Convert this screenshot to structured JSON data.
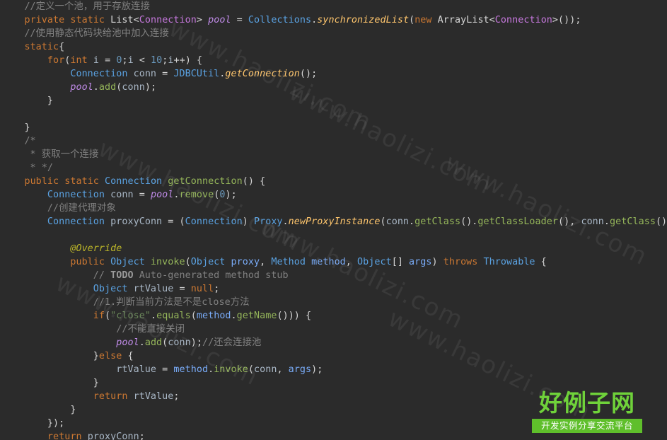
{
  "code_lines": [
    {
      "tokens": [
        {
          "t": "    //定义一个池，用于存放连接",
          "c": "c"
        }
      ]
    },
    {
      "tokens": [
        {
          "t": "    ",
          "c": "t"
        },
        {
          "t": "private",
          "c": "k"
        },
        {
          "t": " ",
          "c": "t"
        },
        {
          "t": "static",
          "c": "k"
        },
        {
          "t": " ",
          "c": "t"
        },
        {
          "t": "List",
          "c": "w"
        },
        {
          "t": "<",
          "c": "t"
        },
        {
          "t": "Connection",
          "c": "tv"
        },
        {
          "t": "> ",
          "c": "t"
        },
        {
          "t": "pool",
          "c": "f"
        },
        {
          "t": " = ",
          "c": "t"
        },
        {
          "t": "Collections",
          "c": "cls"
        },
        {
          "t": ".",
          "c": "t"
        },
        {
          "t": "synchronizedList",
          "c": "sm"
        },
        {
          "t": "(",
          "c": "t"
        },
        {
          "t": "new",
          "c": "k"
        },
        {
          "t": " ",
          "c": "t"
        },
        {
          "t": "ArrayList",
          "c": "w"
        },
        {
          "t": "<",
          "c": "t"
        },
        {
          "t": "Connection",
          "c": "tv"
        },
        {
          "t": ">());",
          "c": "t"
        }
      ]
    },
    {
      "tokens": [
        {
          "t": "    //使用静态代码块给池中加入连接",
          "c": "c"
        }
      ]
    },
    {
      "tokens": [
        {
          "t": "    ",
          "c": "t"
        },
        {
          "t": "static",
          "c": "k"
        },
        {
          "t": "{",
          "c": "t"
        }
      ]
    },
    {
      "tokens": [
        {
          "t": "        ",
          "c": "t"
        },
        {
          "t": "for",
          "c": "k"
        },
        {
          "t": "(",
          "c": "t"
        },
        {
          "t": "int",
          "c": "k"
        },
        {
          "t": " ",
          "c": "t"
        },
        {
          "t": "i",
          "c": "v"
        },
        {
          "t": " = ",
          "c": "t"
        },
        {
          "t": "0",
          "c": "n"
        },
        {
          "t": ";",
          "c": "t"
        },
        {
          "t": "i",
          "c": "v"
        },
        {
          "t": " < ",
          "c": "t"
        },
        {
          "t": "10",
          "c": "n"
        },
        {
          "t": ";",
          "c": "t"
        },
        {
          "t": "i",
          "c": "v"
        },
        {
          "t": "++) {",
          "c": "t"
        }
      ]
    },
    {
      "tokens": [
        {
          "t": "            ",
          "c": "t"
        },
        {
          "t": "Connection",
          "c": "ty"
        },
        {
          "t": " ",
          "c": "t"
        },
        {
          "t": "conn",
          "c": "v"
        },
        {
          "t": " = ",
          "c": "t"
        },
        {
          "t": "JDBCUtil",
          "c": "cls"
        },
        {
          "t": ".",
          "c": "t"
        },
        {
          "t": "getConnection",
          "c": "sm"
        },
        {
          "t": "();",
          "c": "t"
        }
      ]
    },
    {
      "tokens": [
        {
          "t": "            ",
          "c": "t"
        },
        {
          "t": "pool",
          "c": "f"
        },
        {
          "t": ".",
          "c": "t"
        },
        {
          "t": "add",
          "c": "m"
        },
        {
          "t": "(",
          "c": "t"
        },
        {
          "t": "conn",
          "c": "v"
        },
        {
          "t": ");",
          "c": "t"
        }
      ]
    },
    {
      "tokens": [
        {
          "t": "        }",
          "c": "t"
        }
      ]
    },
    {
      "tokens": [
        {
          "t": "",
          "c": "t"
        }
      ]
    },
    {
      "tokens": [
        {
          "t": "    }",
          "c": "t"
        }
      ]
    },
    {
      "tokens": [
        {
          "t": "    /*",
          "c": "c"
        }
      ]
    },
    {
      "tokens": [
        {
          "t": "     * 获取一个连接",
          "c": "c"
        }
      ]
    },
    {
      "tokens": [
        {
          "t": "     * */",
          "c": "c"
        }
      ]
    },
    {
      "tokens": [
        {
          "t": "    ",
          "c": "t"
        },
        {
          "t": "public",
          "c": "k"
        },
        {
          "t": " ",
          "c": "t"
        },
        {
          "t": "static",
          "c": "k"
        },
        {
          "t": " ",
          "c": "t"
        },
        {
          "t": "Connection",
          "c": "ty"
        },
        {
          "t": " ",
          "c": "t"
        },
        {
          "t": "getConnection",
          "c": "m"
        },
        {
          "t": "() {",
          "c": "t"
        }
      ]
    },
    {
      "tokens": [
        {
          "t": "        ",
          "c": "t"
        },
        {
          "t": "Connection",
          "c": "ty"
        },
        {
          "t": " ",
          "c": "t"
        },
        {
          "t": "conn",
          "c": "v"
        },
        {
          "t": " = ",
          "c": "t"
        },
        {
          "t": "pool",
          "c": "f"
        },
        {
          "t": ".",
          "c": "t"
        },
        {
          "t": "remove",
          "c": "m"
        },
        {
          "t": "(",
          "c": "t"
        },
        {
          "t": "0",
          "c": "n"
        },
        {
          "t": ");",
          "c": "t"
        }
      ]
    },
    {
      "tokens": [
        {
          "t": "        //创建代理对象",
          "c": "c"
        }
      ]
    },
    {
      "tokens": [
        {
          "t": "        ",
          "c": "t"
        },
        {
          "t": "Connection",
          "c": "ty"
        },
        {
          "t": " ",
          "c": "t"
        },
        {
          "t": "proxyConn",
          "c": "v"
        },
        {
          "t": " = (",
          "c": "t"
        },
        {
          "t": "Connection",
          "c": "ty"
        },
        {
          "t": ") ",
          "c": "t"
        },
        {
          "t": "Proxy",
          "c": "cls"
        },
        {
          "t": ".",
          "c": "t"
        },
        {
          "t": "newProxyInstance",
          "c": "sm"
        },
        {
          "t": "(",
          "c": "t"
        },
        {
          "t": "conn",
          "c": "v"
        },
        {
          "t": ".",
          "c": "t"
        },
        {
          "t": "getClass",
          "c": "m"
        },
        {
          "t": "().",
          "c": "t"
        },
        {
          "t": "getClassLoader",
          "c": "m"
        },
        {
          "t": "(), ",
          "c": "t"
        },
        {
          "t": "conn",
          "c": "v"
        },
        {
          "t": ".",
          "c": "t"
        },
        {
          "t": "getClass",
          "c": "m"
        },
        {
          "t": "().",
          "c": "t"
        }
      ]
    },
    {
      "tokens": [
        {
          "t": "",
          "c": "t"
        }
      ]
    },
    {
      "tokens": [
        {
          "t": "            ",
          "c": "t"
        },
        {
          "t": "@Override",
          "c": "a"
        }
      ]
    },
    {
      "tokens": [
        {
          "t": "            ",
          "c": "t"
        },
        {
          "t": "public",
          "c": "k"
        },
        {
          "t": " ",
          "c": "t"
        },
        {
          "t": "Object",
          "c": "ty"
        },
        {
          "t": " ",
          "c": "t"
        },
        {
          "t": "invoke",
          "c": "m"
        },
        {
          "t": "(",
          "c": "t"
        },
        {
          "t": "Object",
          "c": "ty"
        },
        {
          "t": " ",
          "c": "t"
        },
        {
          "t": "proxy",
          "c": "p"
        },
        {
          "t": ", ",
          "c": "t"
        },
        {
          "t": "Method",
          "c": "ty"
        },
        {
          "t": " ",
          "c": "t"
        },
        {
          "t": "method",
          "c": "p"
        },
        {
          "t": ", ",
          "c": "t"
        },
        {
          "t": "Object",
          "c": "ty"
        },
        {
          "t": "[] ",
          "c": "t"
        },
        {
          "t": "args",
          "c": "p"
        },
        {
          "t": ") ",
          "c": "t"
        },
        {
          "t": "throws",
          "c": "k"
        },
        {
          "t": " ",
          "c": "t"
        },
        {
          "t": "Throwable",
          "c": "ty"
        },
        {
          "t": " {",
          "c": "t"
        }
      ]
    },
    {
      "tokens": [
        {
          "t": "                // ",
          "c": "c"
        },
        {
          "t": "TODO",
          "c": "tb"
        },
        {
          "t": " Auto-generated method stub",
          "c": "c"
        }
      ]
    },
    {
      "tokens": [
        {
          "t": "                ",
          "c": "t"
        },
        {
          "t": "Object",
          "c": "ty"
        },
        {
          "t": " ",
          "c": "t"
        },
        {
          "t": "rtValue",
          "c": "v"
        },
        {
          "t": " = ",
          "c": "t"
        },
        {
          "t": "null",
          "c": "k"
        },
        {
          "t": ";",
          "c": "t"
        }
      ]
    },
    {
      "tokens": [
        {
          "t": "                //1.判断当前方法是不是close方法",
          "c": "c"
        }
      ]
    },
    {
      "tokens": [
        {
          "t": "                ",
          "c": "t"
        },
        {
          "t": "if",
          "c": "k"
        },
        {
          "t": "(",
          "c": "t"
        },
        {
          "t": "\"close\"",
          "c": "s"
        },
        {
          "t": ".",
          "c": "t"
        },
        {
          "t": "equals",
          "c": "m"
        },
        {
          "t": "(",
          "c": "t"
        },
        {
          "t": "method",
          "c": "p"
        },
        {
          "t": ".",
          "c": "t"
        },
        {
          "t": "getName",
          "c": "m"
        },
        {
          "t": "())) {",
          "c": "t"
        }
      ]
    },
    {
      "tokens": [
        {
          "t": "                    //不能直接关闭",
          "c": "c"
        }
      ]
    },
    {
      "tokens": [
        {
          "t": "                    ",
          "c": "t"
        },
        {
          "t": "pool",
          "c": "f"
        },
        {
          "t": ".",
          "c": "t"
        },
        {
          "t": "add",
          "c": "m"
        },
        {
          "t": "(",
          "c": "t"
        },
        {
          "t": "conn",
          "c": "v"
        },
        {
          "t": ");",
          "c": "t"
        },
        {
          "t": "//还会连接池",
          "c": "c"
        }
      ]
    },
    {
      "tokens": [
        {
          "t": "                }",
          "c": "t"
        },
        {
          "t": "else",
          "c": "k"
        },
        {
          "t": " {",
          "c": "t"
        }
      ]
    },
    {
      "tokens": [
        {
          "t": "                    ",
          "c": "t"
        },
        {
          "t": "rtValue",
          "c": "v"
        },
        {
          "t": " = ",
          "c": "t"
        },
        {
          "t": "method",
          "c": "p"
        },
        {
          "t": ".",
          "c": "t"
        },
        {
          "t": "invoke",
          "c": "m"
        },
        {
          "t": "(",
          "c": "t"
        },
        {
          "t": "conn",
          "c": "v"
        },
        {
          "t": ", ",
          "c": "t"
        },
        {
          "t": "args",
          "c": "p"
        },
        {
          "t": ");",
          "c": "t"
        }
      ]
    },
    {
      "tokens": [
        {
          "t": "                }",
          "c": "t"
        }
      ]
    },
    {
      "tokens": [
        {
          "t": "                ",
          "c": "t"
        },
        {
          "t": "return",
          "c": "k"
        },
        {
          "t": " ",
          "c": "t"
        },
        {
          "t": "rtValue",
          "c": "v"
        },
        {
          "t": ";",
          "c": "t"
        }
      ]
    },
    {
      "tokens": [
        {
          "t": "            }",
          "c": "t"
        }
      ]
    },
    {
      "tokens": [
        {
          "t": "        });",
          "c": "t"
        }
      ]
    },
    {
      "tokens": [
        {
          "t": "        ",
          "c": "t"
        },
        {
          "t": "return",
          "c": "k"
        },
        {
          "t": " ",
          "c": "t"
        },
        {
          "t": "proxyConn",
          "c": "v"
        },
        {
          "t": ";",
          "c": "t"
        }
      ]
    }
  ],
  "watermark": {
    "text": "www.haolizi.com"
  },
  "logo": {
    "title": "好例子网",
    "subtitle": "开发实例分享交流平台"
  },
  "colors": {
    "background": "#2b2b2b",
    "keyword": "#cc7832",
    "comment": "#808080",
    "type": "#5aa2e2",
    "method": "#95b65a",
    "logo_green": "#5fbf2b"
  }
}
